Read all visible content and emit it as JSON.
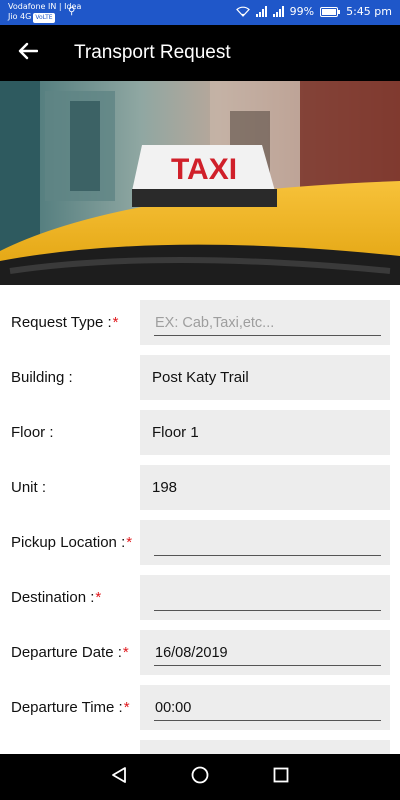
{
  "status_bar": {
    "carrier_line1": "Vodafone IN | Idea",
    "carrier_line2": "Jio 4G",
    "volte": "VoLTE",
    "battery": "99%",
    "time": "5:45 pm"
  },
  "app_bar": {
    "title": "Transport Request"
  },
  "hero": {
    "sign_text": "TAXI"
  },
  "form": {
    "request_type_label": "Request Type :",
    "request_type_placeholder": "EX: Cab,Taxi,etc...",
    "building_label": "Building :",
    "building_value": "Post Katy Trail",
    "floor_label": "Floor :",
    "floor_value": "Floor 1",
    "unit_label": "Unit :",
    "unit_value": "198",
    "pickup_label": "Pickup Location :",
    "pickup_value": "",
    "destination_label": "Destination :",
    "destination_value": "",
    "departure_date_label": "Departure Date :",
    "departure_date_value": "16/08/2019",
    "departure_time_label": "Departure Time :",
    "departure_time_value": "00:00",
    "required_marker": "*"
  },
  "colors": {
    "status_bar": "#1f57c9",
    "app_bar": "#000000",
    "field_bg": "#ededed",
    "required": "#e0171b"
  },
  "icons": {
    "back": "arrow-left-icon",
    "nav_back": "triangle-back-icon",
    "nav_home": "circle-home-icon",
    "nav_recents": "square-recents-icon"
  }
}
